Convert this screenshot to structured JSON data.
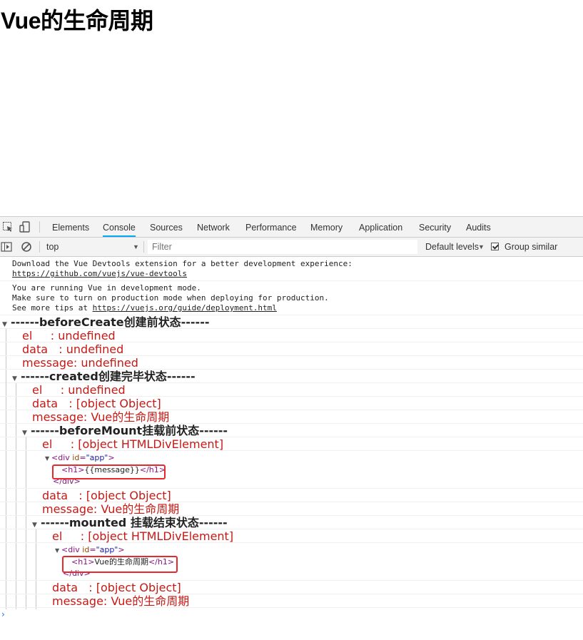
{
  "page": {
    "title": "Vue的生命周期"
  },
  "devtools": {
    "tabs": [
      "Elements",
      "Console",
      "Sources",
      "Network",
      "Performance",
      "Memory",
      "Application",
      "Security",
      "Audits"
    ],
    "active_tab": "Console",
    "context": "top",
    "filter_placeholder": "Filter",
    "levels": "Default levels",
    "group_similar": "Group similar",
    "group_similar_checked": true
  },
  "console": {
    "devtools_msg": {
      "text": "Download the Vue Devtools extension for a better development experience:",
      "link": "https://github.com/vuejs/vue-devtools"
    },
    "prod_msg": {
      "line1": "You are running Vue in development mode.",
      "line2": "Make sure to turn on production mode when deploying for production.",
      "line3_prefix": "See more tips at ",
      "link": "https://vuejs.org/guide/deployment.html"
    },
    "groups": [
      {
        "label": "------beforeCreate创建前状态------",
        "el": "el     : undefined",
        "data": "data   : undefined",
        "message": "message: undefined"
      },
      {
        "label": "------created创建完毕状态------",
        "el": "el     : undefined",
        "data": "data   : [object Object]",
        "message": "message: Vue的生命周期"
      },
      {
        "label": "------beforeMount挂载前状态------",
        "el": "el     : [object HTMLDivElement]",
        "dom_open_tag": "div",
        "dom_attr": "id",
        "dom_attr_val": "\"app\"",
        "dom_inner": "{{message}}",
        "dom_inner_tag": "h1",
        "data": "data   : [object Object]",
        "message": "message: Vue的生命周期"
      },
      {
        "label": "------mounted 挂载结束状态------",
        "el": "el     : [object HTMLDivElement]",
        "dom_open_tag": "div",
        "dom_attr": "id",
        "dom_attr_val": "\"app\"",
        "dom_inner": "Vue的生命周期",
        "dom_inner_tag": "h1",
        "data": "data   : [object Object]",
        "message": "message: Vue的生命周期"
      }
    ]
  },
  "colors": {
    "accent": "#03a9f4",
    "error_text": "#c41a16",
    "highlight": "#e8282b",
    "tag": "#881280"
  }
}
